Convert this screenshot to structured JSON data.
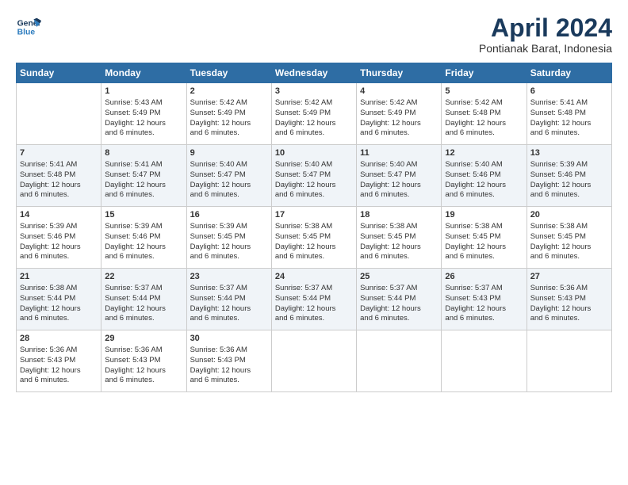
{
  "logo": {
    "line1": "General",
    "line2": "Blue"
  },
  "title": "April 2024",
  "subtitle": "Pontianak Barat, Indonesia",
  "days_header": [
    "Sunday",
    "Monday",
    "Tuesday",
    "Wednesday",
    "Thursday",
    "Friday",
    "Saturday"
  ],
  "weeks": [
    [
      {
        "day": "",
        "info": ""
      },
      {
        "day": "1",
        "info": "Sunrise: 5:43 AM\nSunset: 5:49 PM\nDaylight: 12 hours\nand 6 minutes."
      },
      {
        "day": "2",
        "info": "Sunrise: 5:42 AM\nSunset: 5:49 PM\nDaylight: 12 hours\nand 6 minutes."
      },
      {
        "day": "3",
        "info": "Sunrise: 5:42 AM\nSunset: 5:49 PM\nDaylight: 12 hours\nand 6 minutes."
      },
      {
        "day": "4",
        "info": "Sunrise: 5:42 AM\nSunset: 5:49 PM\nDaylight: 12 hours\nand 6 minutes."
      },
      {
        "day": "5",
        "info": "Sunrise: 5:42 AM\nSunset: 5:48 PM\nDaylight: 12 hours\nand 6 minutes."
      },
      {
        "day": "6",
        "info": "Sunrise: 5:41 AM\nSunset: 5:48 PM\nDaylight: 12 hours\nand 6 minutes."
      }
    ],
    [
      {
        "day": "7",
        "info": "Sunrise: 5:41 AM\nSunset: 5:48 PM\nDaylight: 12 hours\nand 6 minutes."
      },
      {
        "day": "8",
        "info": "Sunrise: 5:41 AM\nSunset: 5:47 PM\nDaylight: 12 hours\nand 6 minutes."
      },
      {
        "day": "9",
        "info": "Sunrise: 5:40 AM\nSunset: 5:47 PM\nDaylight: 12 hours\nand 6 minutes."
      },
      {
        "day": "10",
        "info": "Sunrise: 5:40 AM\nSunset: 5:47 PM\nDaylight: 12 hours\nand 6 minutes."
      },
      {
        "day": "11",
        "info": "Sunrise: 5:40 AM\nSunset: 5:47 PM\nDaylight: 12 hours\nand 6 minutes."
      },
      {
        "day": "12",
        "info": "Sunrise: 5:40 AM\nSunset: 5:46 PM\nDaylight: 12 hours\nand 6 minutes."
      },
      {
        "day": "13",
        "info": "Sunrise: 5:39 AM\nSunset: 5:46 PM\nDaylight: 12 hours\nand 6 minutes."
      }
    ],
    [
      {
        "day": "14",
        "info": "Sunrise: 5:39 AM\nSunset: 5:46 PM\nDaylight: 12 hours\nand 6 minutes."
      },
      {
        "day": "15",
        "info": "Sunrise: 5:39 AM\nSunset: 5:46 PM\nDaylight: 12 hours\nand 6 minutes."
      },
      {
        "day": "16",
        "info": "Sunrise: 5:39 AM\nSunset: 5:45 PM\nDaylight: 12 hours\nand 6 minutes."
      },
      {
        "day": "17",
        "info": "Sunrise: 5:38 AM\nSunset: 5:45 PM\nDaylight: 12 hours\nand 6 minutes."
      },
      {
        "day": "18",
        "info": "Sunrise: 5:38 AM\nSunset: 5:45 PM\nDaylight: 12 hours\nand 6 minutes."
      },
      {
        "day": "19",
        "info": "Sunrise: 5:38 AM\nSunset: 5:45 PM\nDaylight: 12 hours\nand 6 minutes."
      },
      {
        "day": "20",
        "info": "Sunrise: 5:38 AM\nSunset: 5:45 PM\nDaylight: 12 hours\nand 6 minutes."
      }
    ],
    [
      {
        "day": "21",
        "info": "Sunrise: 5:38 AM\nSunset: 5:44 PM\nDaylight: 12 hours\nand 6 minutes."
      },
      {
        "day": "22",
        "info": "Sunrise: 5:37 AM\nSunset: 5:44 PM\nDaylight: 12 hours\nand 6 minutes."
      },
      {
        "day": "23",
        "info": "Sunrise: 5:37 AM\nSunset: 5:44 PM\nDaylight: 12 hours\nand 6 minutes."
      },
      {
        "day": "24",
        "info": "Sunrise: 5:37 AM\nSunset: 5:44 PM\nDaylight: 12 hours\nand 6 minutes."
      },
      {
        "day": "25",
        "info": "Sunrise: 5:37 AM\nSunset: 5:44 PM\nDaylight: 12 hours\nand 6 minutes."
      },
      {
        "day": "26",
        "info": "Sunrise: 5:37 AM\nSunset: 5:43 PM\nDaylight: 12 hours\nand 6 minutes."
      },
      {
        "day": "27",
        "info": "Sunrise: 5:36 AM\nSunset: 5:43 PM\nDaylight: 12 hours\nand 6 minutes."
      }
    ],
    [
      {
        "day": "28",
        "info": "Sunrise: 5:36 AM\nSunset: 5:43 PM\nDaylight: 12 hours\nand 6 minutes."
      },
      {
        "day": "29",
        "info": "Sunrise: 5:36 AM\nSunset: 5:43 PM\nDaylight: 12 hours\nand 6 minutes."
      },
      {
        "day": "30",
        "info": "Sunrise: 5:36 AM\nSunset: 5:43 PM\nDaylight: 12 hours\nand 6 minutes."
      },
      {
        "day": "",
        "info": ""
      },
      {
        "day": "",
        "info": ""
      },
      {
        "day": "",
        "info": ""
      },
      {
        "day": "",
        "info": ""
      }
    ]
  ]
}
